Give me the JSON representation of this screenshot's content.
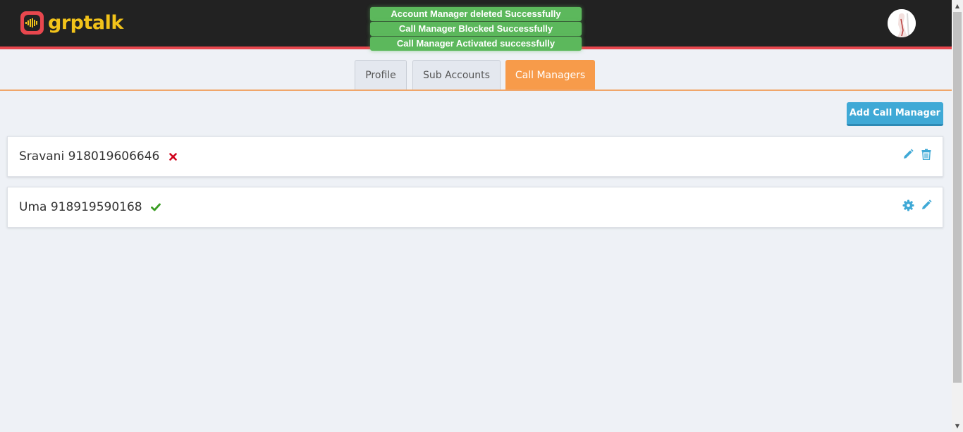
{
  "header": {
    "logo_text": "grptalk",
    "logo_icon": "soundwave-logo-icon",
    "avatar_icon": "user-avatar"
  },
  "toasts": [
    "Account Manager deleted Successfully",
    "Call Manager Blocked Successfully",
    "Call Manager Activated successfully"
  ],
  "tabs": [
    {
      "label": "Profile",
      "active": false
    },
    {
      "label": "Sub Accounts",
      "active": false
    },
    {
      "label": "Call Managers",
      "active": true
    }
  ],
  "actions": {
    "add_label": "Add Call Manager"
  },
  "call_managers": [
    {
      "name": "Sravani 918019606646",
      "status": "blocked",
      "status_icon": "x-icon",
      "action_icons": [
        "pencil-icon",
        "trash-icon"
      ]
    },
    {
      "name": "Uma 918919590168",
      "status": "active",
      "status_icon": "check-icon",
      "action_icons": [
        "gear-icon",
        "pencil-icon"
      ]
    }
  ],
  "colors": {
    "header_bg": "#222222",
    "header_accent": "#e8474e",
    "logo_yellow": "#f2c31a",
    "toast_green": "#5cb85c",
    "tab_active": "#f79b4a",
    "button_blue": "#3fa9d6",
    "status_blocked": "#d0021b",
    "status_active": "#3a9d23",
    "icon_blue": "#3fa9d6"
  }
}
